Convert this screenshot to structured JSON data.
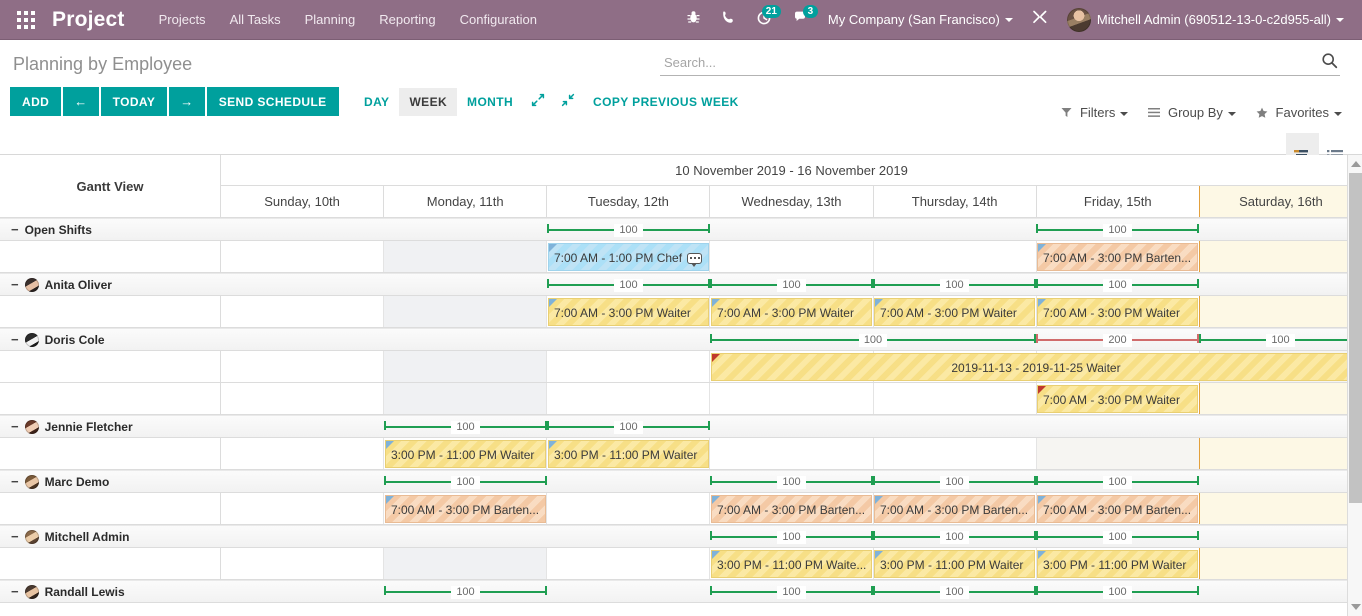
{
  "topnav": {
    "apps_icon": "grid-apps-icon",
    "brand": "Project",
    "links": [
      "Projects",
      "All Tasks",
      "Planning",
      "Reporting",
      "Configuration"
    ],
    "icons": [
      {
        "name": "bug-icon",
        "glyph": "⚕",
        "badge": ""
      },
      {
        "name": "phone-icon",
        "glyph": "☎",
        "badge": ""
      },
      {
        "name": "activity-clock-icon",
        "glyph": "◔",
        "badge": "21"
      },
      {
        "name": "messages-icon",
        "glyph": "●",
        "badge": "3"
      }
    ],
    "company": "My Company (San Francisco)",
    "debug_icon": "wrench-tools-icon",
    "user": "Mitchell Admin (690512-13-0-c2d955-all)"
  },
  "control_panel": {
    "page_title": "Planning by Employee",
    "search_placeholder": "Search...",
    "search_value": "",
    "search_icon": "magnifier-icon",
    "buttons": {
      "add": "ADD",
      "prev": "←",
      "today": "TODAY",
      "next": "→",
      "send_schedule": "SEND SCHEDULE"
    },
    "scales": [
      {
        "label": "DAY",
        "active": false
      },
      {
        "label": "WEEK",
        "active": true
      },
      {
        "label": "MONTH",
        "active": false
      }
    ],
    "expand_icon": "expand-arrows-icon",
    "collapse_icon": "collapse-arrows-icon",
    "copy_previous_week": "COPY PREVIOUS WEEK",
    "filters": "Filters",
    "group_by": "Group By",
    "favorites": "Favorites",
    "view_gantt_icon": "gantt-view-icon",
    "view_list_icon": "list-view-icon"
  },
  "gantt": {
    "side_header": "Gantt View",
    "period_title": "10 November 2019 - 16 November 2019",
    "days": [
      {
        "label": "Sunday, 10th",
        "today": false
      },
      {
        "label": "Monday, 11th",
        "today": false
      },
      {
        "label": "Tuesday, 12th",
        "today": false
      },
      {
        "label": "Wednesday, 13th",
        "today": false
      },
      {
        "label": "Thursday, 14th",
        "today": false
      },
      {
        "label": "Friday, 15th",
        "today": false
      },
      {
        "label": "Saturday, 16th",
        "today": true
      }
    ],
    "rows": [
      {
        "name": "Open Shifts",
        "avatar": false,
        "collapse": "−",
        "progress": [
          {
            "day": 2,
            "span": 1,
            "value": "100",
            "over": false
          },
          {
            "day": 5,
            "span": 1,
            "value": "100",
            "over": false
          }
        ],
        "slots": [
          {
            "label": "7:00 AM - 1:00 PM Chef",
            "day": 2,
            "span": 1,
            "color": "blue",
            "comment": true,
            "center": false,
            "flag": "blue"
          },
          {
            "label": "7:00 AM - 3:00 PM Barten...",
            "day": 5,
            "span": 1,
            "color": "orange",
            "comment": false,
            "center": false,
            "flag": "blue"
          }
        ],
        "slot_rows": 1
      },
      {
        "name": "Anita Oliver",
        "avatar": true,
        "collapse": "−",
        "progress": [
          {
            "day": 2,
            "span": 1,
            "value": "100",
            "over": false
          },
          {
            "day": 3,
            "span": 1,
            "value": "100",
            "over": false
          },
          {
            "day": 4,
            "span": 1,
            "value": "100",
            "over": false
          },
          {
            "day": 5,
            "span": 1,
            "value": "100",
            "over": false
          }
        ],
        "slots": [
          {
            "label": "7:00 AM - 3:00 PM Waiter",
            "day": 2,
            "span": 1,
            "color": "yellow",
            "comment": false,
            "center": false,
            "flag": "blue"
          },
          {
            "label": "7:00 AM - 3:00 PM Waiter",
            "day": 3,
            "span": 1,
            "color": "yellow",
            "comment": false,
            "center": false,
            "flag": "blue"
          },
          {
            "label": "7:00 AM - 3:00 PM Waiter",
            "day": 4,
            "span": 1,
            "color": "yellow",
            "comment": false,
            "center": false,
            "flag": "blue"
          },
          {
            "label": "7:00 AM - 3:00 PM Waiter",
            "day": 5,
            "span": 1,
            "color": "yellow",
            "comment": false,
            "center": false,
            "flag": "blue"
          }
        ],
        "slot_rows": 1
      },
      {
        "name": "Doris Cole",
        "avatar": true,
        "collapse": "−",
        "progress": [
          {
            "day": 3,
            "span": 2,
            "value": "100",
            "over": false
          },
          {
            "day": 5,
            "span": 1,
            "value": "200",
            "over": true
          },
          {
            "day": 6,
            "span": 1,
            "value": "100",
            "over": false
          }
        ],
        "slots": [
          {
            "label": "2019-11-13 - 2019-11-25 Waiter",
            "day": 3,
            "span": 4,
            "color": "yellow",
            "comment": false,
            "center": true,
            "flag": "red",
            "row": 0
          },
          {
            "label": "7:00 AM - 3:00 PM Waiter",
            "day": 5,
            "span": 1,
            "color": "yellow",
            "comment": false,
            "center": false,
            "flag": "red",
            "row": 1
          }
        ],
        "slot_rows": 2
      },
      {
        "name": "Jennie Fletcher",
        "avatar": true,
        "collapse": "−",
        "progress": [
          {
            "day": 1,
            "span": 1,
            "value": "100",
            "over": false
          },
          {
            "day": 2,
            "span": 1,
            "value": "100",
            "over": false
          }
        ],
        "slots": [
          {
            "label": "3:00 PM - 11:00 PM Waiter",
            "day": 1,
            "span": 1,
            "color": "yellow",
            "comment": false,
            "center": false,
            "flag": "blue"
          },
          {
            "label": "3:00 PM - 11:00 PM Waiter",
            "day": 2,
            "span": 1,
            "color": "yellow",
            "comment": false,
            "center": false,
            "flag": "blue"
          }
        ],
        "slot_rows": 1
      },
      {
        "name": "Marc Demo",
        "avatar": true,
        "collapse": "−",
        "progress": [
          {
            "day": 1,
            "span": 1,
            "value": "100",
            "over": false
          },
          {
            "day": 3,
            "span": 1,
            "value": "100",
            "over": false
          },
          {
            "day": 4,
            "span": 1,
            "value": "100",
            "over": false
          },
          {
            "day": 5,
            "span": 1,
            "value": "100",
            "over": false
          }
        ],
        "slots": [
          {
            "label": "7:00 AM - 3:00 PM Barten...",
            "day": 1,
            "span": 1,
            "color": "orange",
            "comment": false,
            "center": false,
            "flag": "blue"
          },
          {
            "label": "7:00 AM - 3:00 PM Barten...",
            "day": 3,
            "span": 1,
            "color": "orange",
            "comment": false,
            "center": false,
            "flag": "blue"
          },
          {
            "label": "7:00 AM - 3:00 PM Barten...",
            "day": 4,
            "span": 1,
            "color": "orange",
            "comment": false,
            "center": false,
            "flag": "blue"
          },
          {
            "label": "7:00 AM - 3:00 PM Barten...",
            "day": 5,
            "span": 1,
            "color": "orange",
            "comment": false,
            "center": false,
            "flag": "blue"
          }
        ],
        "slot_rows": 1
      },
      {
        "name": "Mitchell Admin",
        "avatar": true,
        "collapse": "−",
        "progress": [
          {
            "day": 3,
            "span": 1,
            "value": "100",
            "over": false
          },
          {
            "day": 4,
            "span": 1,
            "value": "100",
            "over": false
          },
          {
            "day": 5,
            "span": 1,
            "value": "100",
            "over": false
          }
        ],
        "slots": [
          {
            "label": "3:00 PM - 11:00 PM Waite...",
            "day": 3,
            "span": 1,
            "color": "yellow",
            "comment": false,
            "center": false,
            "flag": "blue"
          },
          {
            "label": "3:00 PM - 11:00 PM Waiter",
            "day": 4,
            "span": 1,
            "color": "yellow",
            "comment": false,
            "center": false,
            "flag": "blue"
          },
          {
            "label": "3:00 PM - 11:00 PM Waiter",
            "day": 5,
            "span": 1,
            "color": "yellow",
            "comment": false,
            "center": false,
            "flag": "blue"
          }
        ],
        "slot_rows": 1
      },
      {
        "name": "Randall Lewis",
        "avatar": true,
        "collapse": "−",
        "progress": [
          {
            "day": 1,
            "span": 1,
            "value": "100",
            "over": false
          },
          {
            "day": 3,
            "span": 1,
            "value": "100",
            "over": false
          },
          {
            "day": 4,
            "span": 1,
            "value": "100",
            "over": false
          },
          {
            "day": 5,
            "span": 1,
            "value": "100",
            "over": false
          }
        ],
        "slots": [],
        "slot_rows": 0
      }
    ]
  },
  "colors": {
    "brand_purple": "#8f6e86",
    "accent_teal": "#00a09d",
    "progress_ok": "#1f9e52",
    "progress_over": "#d06b6b",
    "today_bg": "#fdf8e5"
  }
}
